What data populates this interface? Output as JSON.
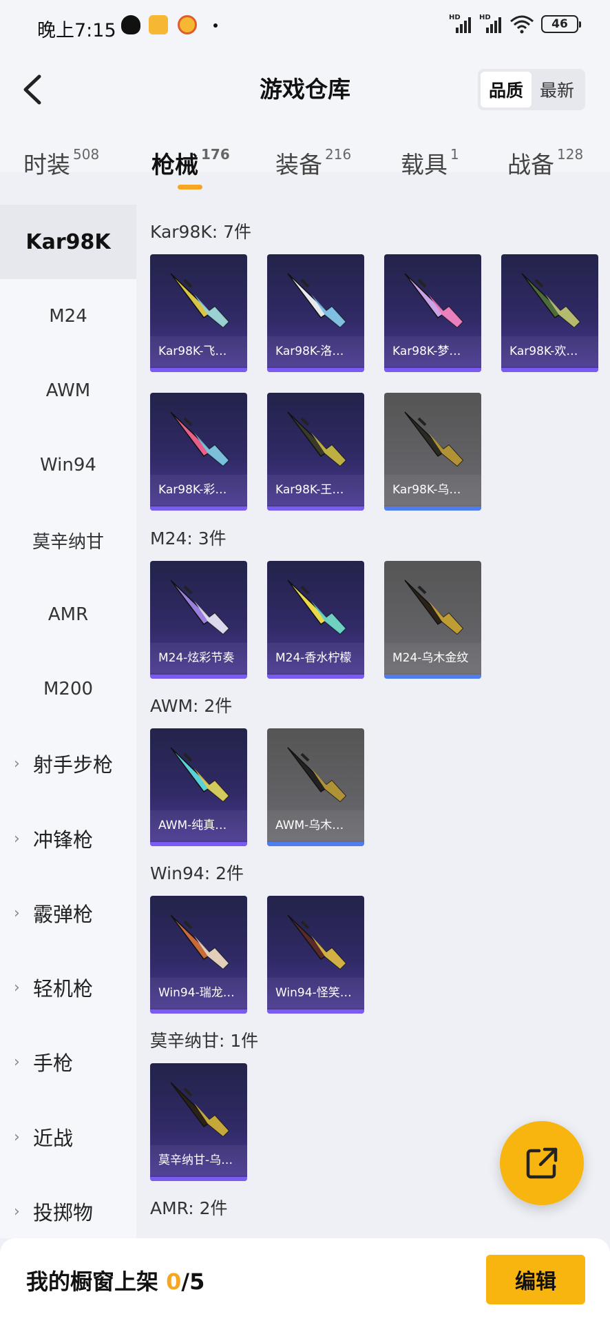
{
  "status_bar": {
    "time": "晚上7:15",
    "battery": "46",
    "signal_tag": "HD"
  },
  "header": {
    "title": "游戏仓库",
    "sort_options": [
      "品质",
      "最新"
    ],
    "sort_active": 0
  },
  "tabs": [
    {
      "label": "时装",
      "count": "508"
    },
    {
      "label": "枪械",
      "count": "176"
    },
    {
      "label": "装备",
      "count": "216"
    },
    {
      "label": "载具",
      "count": "1"
    },
    {
      "label": "战备",
      "count": "128"
    }
  ],
  "sidebar": {
    "items": [
      "Kar98K",
      "M24",
      "AWM",
      "Win94",
      "莫辛纳甘",
      "AMR",
      "M200"
    ],
    "groups": [
      "射手步枪",
      "冲锋枪",
      "霰弹枪",
      "轻机枪",
      "手枪",
      "近战",
      "投掷物"
    ]
  },
  "sections": [
    {
      "title": "Kar98K: 7件",
      "items": [
        {
          "label": "Kar98K-飞…",
          "style": "purple"
        },
        {
          "label": "Kar98K-洛…",
          "style": "purple"
        },
        {
          "label": "Kar98K-梦…",
          "style": "purple"
        },
        {
          "label": "Kar98K-欢…",
          "style": "purple"
        },
        {
          "label": "Kar98K-彩…",
          "style": "purple"
        },
        {
          "label": "Kar98K-王…",
          "style": "purple"
        },
        {
          "label": "Kar98K-乌…",
          "style": "grey"
        }
      ]
    },
    {
      "title": "M24: 3件",
      "items": [
        {
          "label": "M24-炫彩节奏",
          "style": "purple"
        },
        {
          "label": "M24-香水柠檬",
          "style": "purple"
        },
        {
          "label": "M24-乌木金纹",
          "style": "grey"
        }
      ]
    },
    {
      "title": "AWM: 2件",
      "items": [
        {
          "label": "AWM-纯真…",
          "style": "purple"
        },
        {
          "label": "AWM-乌木…",
          "style": "grey"
        }
      ]
    },
    {
      "title": "Win94: 2件",
      "items": [
        {
          "label": "Win94-瑞龙…",
          "style": "purple"
        },
        {
          "label": "Win94-怪笑…",
          "style": "purple"
        }
      ]
    },
    {
      "title": "莫辛纳甘: 1件",
      "items": [
        {
          "label": "莫辛纳甘-乌…",
          "style": "purple"
        }
      ]
    },
    {
      "title": "AMR: 2件",
      "items": []
    }
  ],
  "bottom_bar": {
    "text": "我的橱窗上架",
    "current": "0",
    "sep": "/",
    "max": "5",
    "edit_label": "编辑"
  },
  "colors": {
    "accent": "#f8b40f",
    "card_purple": "#302a66",
    "card_grey": "#626266"
  }
}
